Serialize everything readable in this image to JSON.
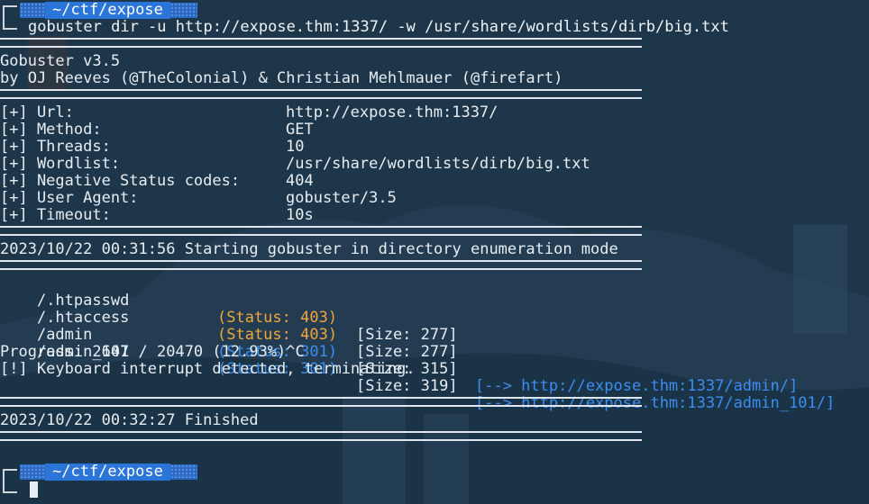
{
  "prompt": {
    "path": "~/ctf/expose"
  },
  "command": "gobuster dir -u http://expose.thm:1337/ -w /usr/share/wordlists/dirb/big.txt",
  "banner": {
    "version": "Gobuster v3.5",
    "authors": "by OJ Reeves (@TheColonial) & Christian Mehlmauer (@firefart)"
  },
  "config": [
    {
      "key": "[+] Url:",
      "value": "http://expose.thm:1337/"
    },
    {
      "key": "[+] Method:",
      "value": "GET"
    },
    {
      "key": "[+] Threads:",
      "value": "10"
    },
    {
      "key": "[+] Wordlist:",
      "value": "/usr/share/wordlists/dirb/big.txt"
    },
    {
      "key": "[+] Negative Status codes:",
      "value": "404"
    },
    {
      "key": "[+] User Agent:",
      "value": "gobuster/3.5"
    },
    {
      "key": "[+] Timeout:",
      "value": "10s"
    }
  ],
  "start_line": "2023/10/22 00:31:56 Starting gobuster in directory enumeration mode",
  "results": [
    {
      "path": "/.htpasswd",
      "status": "(Status: 403)",
      "size": "[Size: 277]",
      "redirect": "",
      "color": "#f0a63a"
    },
    {
      "path": "/.htaccess",
      "status": "(Status: 403)",
      "size": "[Size: 277]",
      "redirect": "",
      "color": "#f0a63a"
    },
    {
      "path": "/admin",
      "status": "(Status: 301)",
      "size": "[Size: 315]",
      "redirect": "[--> http://expose.thm:1337/admin/]",
      "color": "#3d8ef0"
    },
    {
      "path": "/admin_101",
      "status": "(Status: 301)",
      "size": "[Size: 319]",
      "redirect": "[--> http://expose.thm:1337/admin_101/]",
      "color": "#3d8ef0"
    }
  ],
  "progress": "Progress: 2647 / 20470 (12.93%)^C",
  "interrupt": "[!] Keyboard interrupt detected, terminating.",
  "finished": "2023/10/22 00:32:27 Finished",
  "colors": {
    "accent": "#2b74d8",
    "status_403": "#f0a63a",
    "status_301": "#3d8ef0"
  }
}
